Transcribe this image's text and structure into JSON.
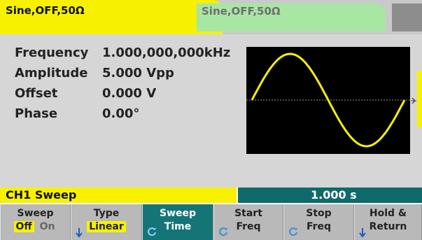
{
  "tabs": {
    "ch1": "Sine,OFF,50Ω",
    "ch2": "Sine,OFF,50Ω"
  },
  "parameters": [
    {
      "label": "Frequency",
      "value": "1.000,000,000kHz"
    },
    {
      "label": "Amplitude",
      "value": "5.000 Vpp"
    },
    {
      "label": "Offset",
      "value": "0.000 V"
    },
    {
      "label": "Phase",
      "value": "0.00°"
    }
  ],
  "waveform": {
    "type": "sine",
    "color": "#f7f100",
    "cycles": 1
  },
  "status": {
    "label": "CH1 Sweep",
    "value": "1.000 s"
  },
  "softkeys": {
    "sweep": {
      "line1": "Sweep",
      "off": "Off",
      "on": "On"
    },
    "type": {
      "line1": "Type",
      "value": "Linear",
      "icon": "down-arrow-icon"
    },
    "sweep_time": {
      "line1": "Sweep",
      "line2": "Time",
      "icon": "knob-icon"
    },
    "start_freq": {
      "line1": "Start",
      "line2": "Freq",
      "icon": "knob-icon"
    },
    "stop_freq": {
      "line1": "Stop",
      "line2": "Freq",
      "icon": "knob-icon"
    },
    "hold_return": {
      "line1": "Hold &",
      "line2": "Return",
      "icon": "down-arrow-icon"
    }
  },
  "colors": {
    "active_channel": "#f7f100",
    "inactive_channel": "#a8e6a4",
    "accent": "#157576"
  }
}
